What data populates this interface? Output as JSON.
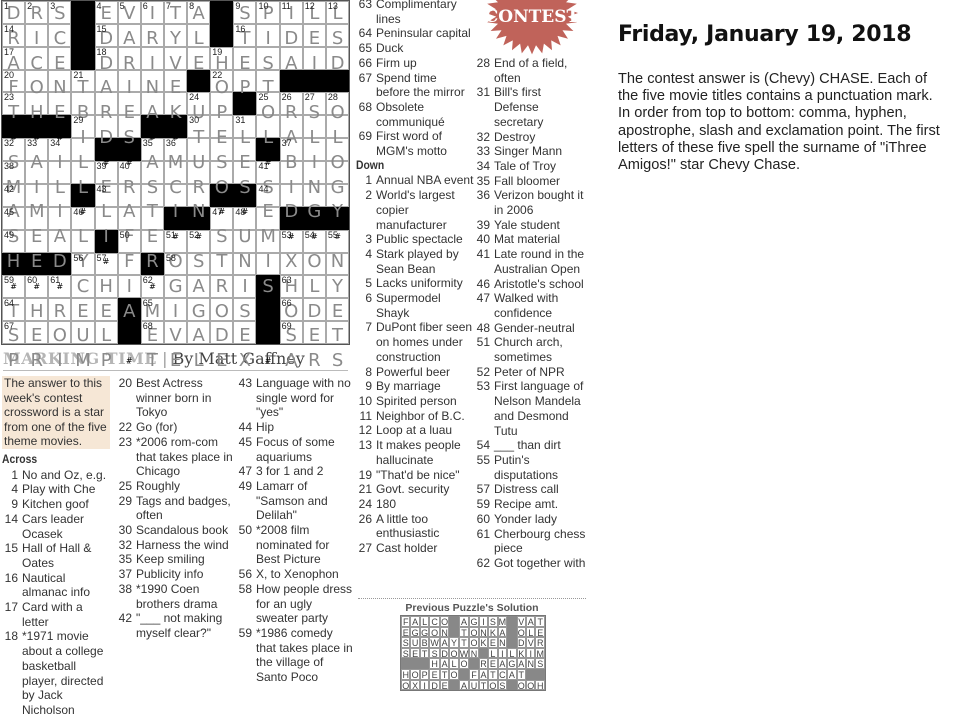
{
  "puzzle": {
    "grid": [
      "DRS#EVITA#SPILL",
      "RIC#DARYL#TIDES",
      "ACE#DRIVEHESAID",
      "FONTAINE#OPT###",
      "THEBREAKUP#ORSO",
      "###IDS##TELLALL",
      "SAIL##AMUSE#BIO",
      "MILLERSCROSSING",
      "AMI#LATIN##EDGY",
      "SEALIFE##SUM###",
      "HEDY#FROSTNIXON",
      "###CHI#GARISHLY",
      "THREEAMIGOS#ODE",
      "SEOUL#EVADE#SET",
      "PRIMP#TELEX#ARS"
    ],
    "title_kicker": "MARKING TIME",
    "title_sep": "|",
    "byline": "By Matt Gaffney",
    "note": "The answer to this week's contest crossword is a star from one of the five theme movies.",
    "badge_text": "CONTEST",
    "across_label": "Across",
    "down_label": "Down",
    "across": [
      {
        "n": "1",
        "t": "No and Oz, e.g."
      },
      {
        "n": "4",
        "t": "Play with Che"
      },
      {
        "n": "9",
        "t": "Kitchen goof"
      },
      {
        "n": "14",
        "t": "Cars leader Ocasek"
      },
      {
        "n": "15",
        "t": "Hall of Hall & Oates"
      },
      {
        "n": "16",
        "t": "Nautical almanac info"
      },
      {
        "n": "17",
        "t": "Card with a letter"
      },
      {
        "n": "18",
        "t": "*1971 movie about a college basketball player, directed by Jack Nicholson"
      },
      {
        "n": "20",
        "t": "Best Actress winner born in Tokyo"
      },
      {
        "n": "22",
        "t": "Go (for)"
      },
      {
        "n": "23",
        "t": "*2006 rom-com that takes place in Chicago"
      },
      {
        "n": "25",
        "t": "Roughly"
      },
      {
        "n": "29",
        "t": "Tags and badges, often"
      },
      {
        "n": "30",
        "t": "Scandalous book"
      },
      {
        "n": "32",
        "t": "Harness the wind"
      },
      {
        "n": "35",
        "t": "Keep smiling"
      },
      {
        "n": "37",
        "t": "Publicity info"
      },
      {
        "n": "38",
        "t": "*1990 Coen brothers drama"
      },
      {
        "n": "42",
        "t": "\"___ not making myself clear?\""
      },
      {
        "n": "43",
        "t": "Language with no single word for \"yes\""
      },
      {
        "n": "44",
        "t": "Hip"
      },
      {
        "n": "45",
        "t": "Focus of some aquariums"
      },
      {
        "n": "47",
        "t": "3 for 1 and 2"
      },
      {
        "n": "49",
        "t": "Lamarr of \"Samson and Delilah\""
      },
      {
        "n": "50",
        "t": "*2008 film nominated for Best Picture"
      },
      {
        "n": "56",
        "t": "X, to Xenophon"
      },
      {
        "n": "58",
        "t": "How people dress for an ugly sweater party"
      },
      {
        "n": "59",
        "t": "*1986 comedy that takes place in the village of Santo Poco"
      },
      {
        "n": "63",
        "t": "Complimentary lines"
      },
      {
        "n": "64",
        "t": "Peninsular capital"
      },
      {
        "n": "65",
        "t": "Duck"
      },
      {
        "n": "66",
        "t": "Firm up"
      },
      {
        "n": "67",
        "t": "Spend time before the mirror"
      },
      {
        "n": "68",
        "t": "Obsolete communiqué"
      },
      {
        "n": "69",
        "t": "First word of MGM's motto"
      }
    ],
    "down": [
      {
        "n": "1",
        "t": "Annual NBA event"
      },
      {
        "n": "2",
        "t": "World's largest copier manufacturer"
      },
      {
        "n": "3",
        "t": "Public spectacle"
      },
      {
        "n": "4",
        "t": "Stark played by Sean Bean"
      },
      {
        "n": "5",
        "t": "Lacks uniformity"
      },
      {
        "n": "6",
        "t": "Supermodel Shayk"
      },
      {
        "n": "7",
        "t": "DuPont fiber seen on homes under construction"
      },
      {
        "n": "8",
        "t": "Powerful beer"
      },
      {
        "n": "9",
        "t": "By marriage"
      },
      {
        "n": "10",
        "t": "Spirited person"
      },
      {
        "n": "11",
        "t": "Neighbor of B.C."
      },
      {
        "n": "12",
        "t": "Loop at a luau"
      },
      {
        "n": "13",
        "t": "It makes people hallucinate"
      },
      {
        "n": "19",
        "t": "\"That'd be nice\""
      },
      {
        "n": "21",
        "t": "Govt. security"
      },
      {
        "n": "24",
        "t": "180"
      },
      {
        "n": "26",
        "t": "A little too enthusiastic"
      },
      {
        "n": "27",
        "t": "Cast holder"
      },
      {
        "n": "28",
        "t": "End of a field, often"
      },
      {
        "n": "31",
        "t": "Bill's first Defense secretary"
      },
      {
        "n": "32",
        "t": "Destroy"
      },
      {
        "n": "33",
        "t": "Singer Mann"
      },
      {
        "n": "34",
        "t": "Tale of Troy"
      },
      {
        "n": "35",
        "t": "Fall bloomer"
      },
      {
        "n": "36",
        "t": "Verizon bought it in 2006"
      },
      {
        "n": "39",
        "t": "Yale student"
      },
      {
        "n": "40",
        "t": "Mat material"
      },
      {
        "n": "41",
        "t": "Late round in the Australian Open"
      },
      {
        "n": "46",
        "t": "Aristotle's school"
      },
      {
        "n": "47",
        "t": "Walked with confidence"
      },
      {
        "n": "48",
        "t": "Gender-neutral"
      },
      {
        "n": "51",
        "t": "Church arch, sometimes"
      },
      {
        "n": "52",
        "t": "Peter of NPR"
      },
      {
        "n": "53",
        "t": "First language of Nelson Mandela and Desmond Tutu"
      },
      {
        "n": "54",
        "t": "___ than dirt"
      },
      {
        "n": "55",
        "t": "Putin's disputations"
      },
      {
        "n": "57",
        "t": "Distress call"
      },
      {
        "n": "59",
        "t": "Recipe amt."
      },
      {
        "n": "60",
        "t": "Yonder lady"
      },
      {
        "n": "61",
        "t": "Cherbourg chess piece"
      },
      {
        "n": "62",
        "t": "Got together with"
      }
    ],
    "previous_solution": {
      "label": "Previous Puzzle's Solution",
      "grid": [
        "FALCO#AGISM#VAT",
        "EGGON#TONKA#OLE",
        "SUBWAYTOKEN#DVR",
        "SETSDOWN#LILKIM",
        "###HALO#REAGANS",
        "HOPETO#FATCAT##",
        "OXIDE#AUTOS#OOH"
      ]
    }
  },
  "answer": {
    "date": "Friday, January 19, 2018",
    "text": "The contest answer is (Chevy) CHASE. Each of the five movie titles contains a punctuation mark. In order from top to bottom: comma, hyphen, apostrophe, slash and exclamation point. The first letters of these five spell the surname of \"iThree Amigos!\" star Chevy Chase."
  },
  "colors": {
    "badge": "#c0635a",
    "note_bg": "#f6e7d6",
    "black_square": "#000000"
  }
}
